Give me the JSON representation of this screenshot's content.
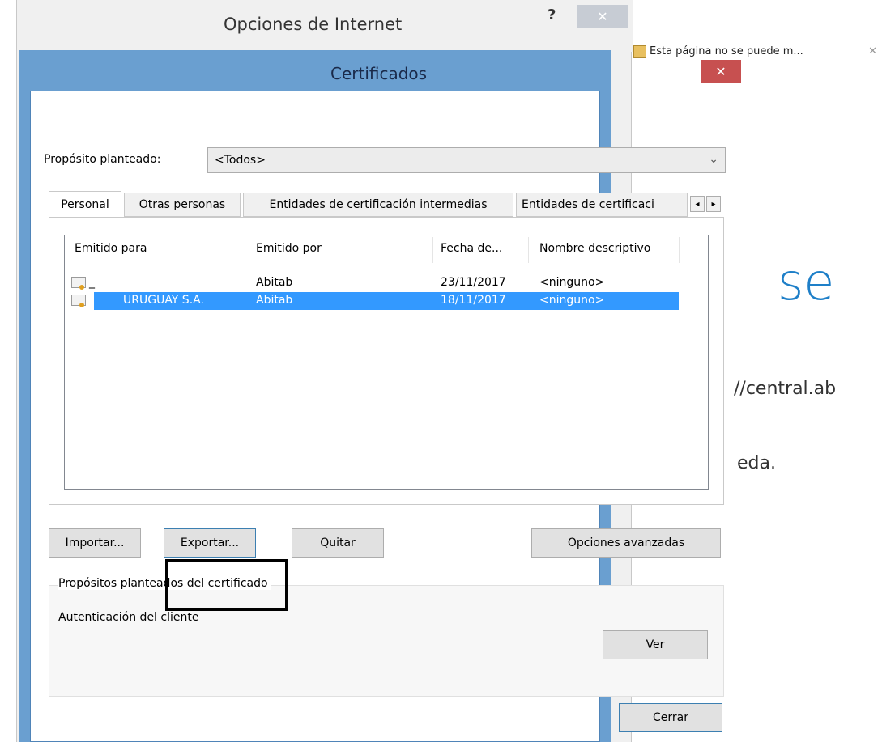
{
  "background_browser": {
    "tab_title": "Esta página no se puede m...",
    "big_text": "se",
    "url_fragment": "//central.ab",
    "text_fragment": "eda."
  },
  "back_dialog": {
    "title": "Opciones de Internet",
    "help": "?",
    "close": "✕"
  },
  "dialog": {
    "title": "Certificados",
    "close": "✕",
    "purpose_label": "Propósito planteado:",
    "purpose_value": "<Todos>",
    "tabs": [
      {
        "label": "Personal",
        "active": true
      },
      {
        "label": "Otras personas",
        "active": false
      },
      {
        "label": "Entidades de certificación intermedias",
        "active": false
      },
      {
        "label": "Entidades de certificaci",
        "active": false
      }
    ],
    "tab_scroll_left": "◂",
    "tab_scroll_right": "▸",
    "columns": [
      "Emitido para",
      "Emitido por",
      "Fecha de...",
      "Nombre descriptivo"
    ],
    "rows": [
      {
        "issued_to": "_",
        "issued_by": "Abitab",
        "date": "23/11/2017",
        "friendly": "<ninguno>",
        "selected": false
      },
      {
        "issued_to": "URUGUAY S.A.",
        "issued_by": "Abitab",
        "date": "18/11/2017",
        "friendly": "<ninguno>",
        "selected": true
      }
    ],
    "buttons": {
      "import": "Importar...",
      "export": "Exportar...",
      "remove": "Quitar",
      "advanced": "Opciones avanzadas",
      "view": "Ver",
      "close": "Cerrar"
    },
    "purposes_group_label": "Propósitos planteados del certificado",
    "purposes_value": "Autenticación del cliente"
  }
}
